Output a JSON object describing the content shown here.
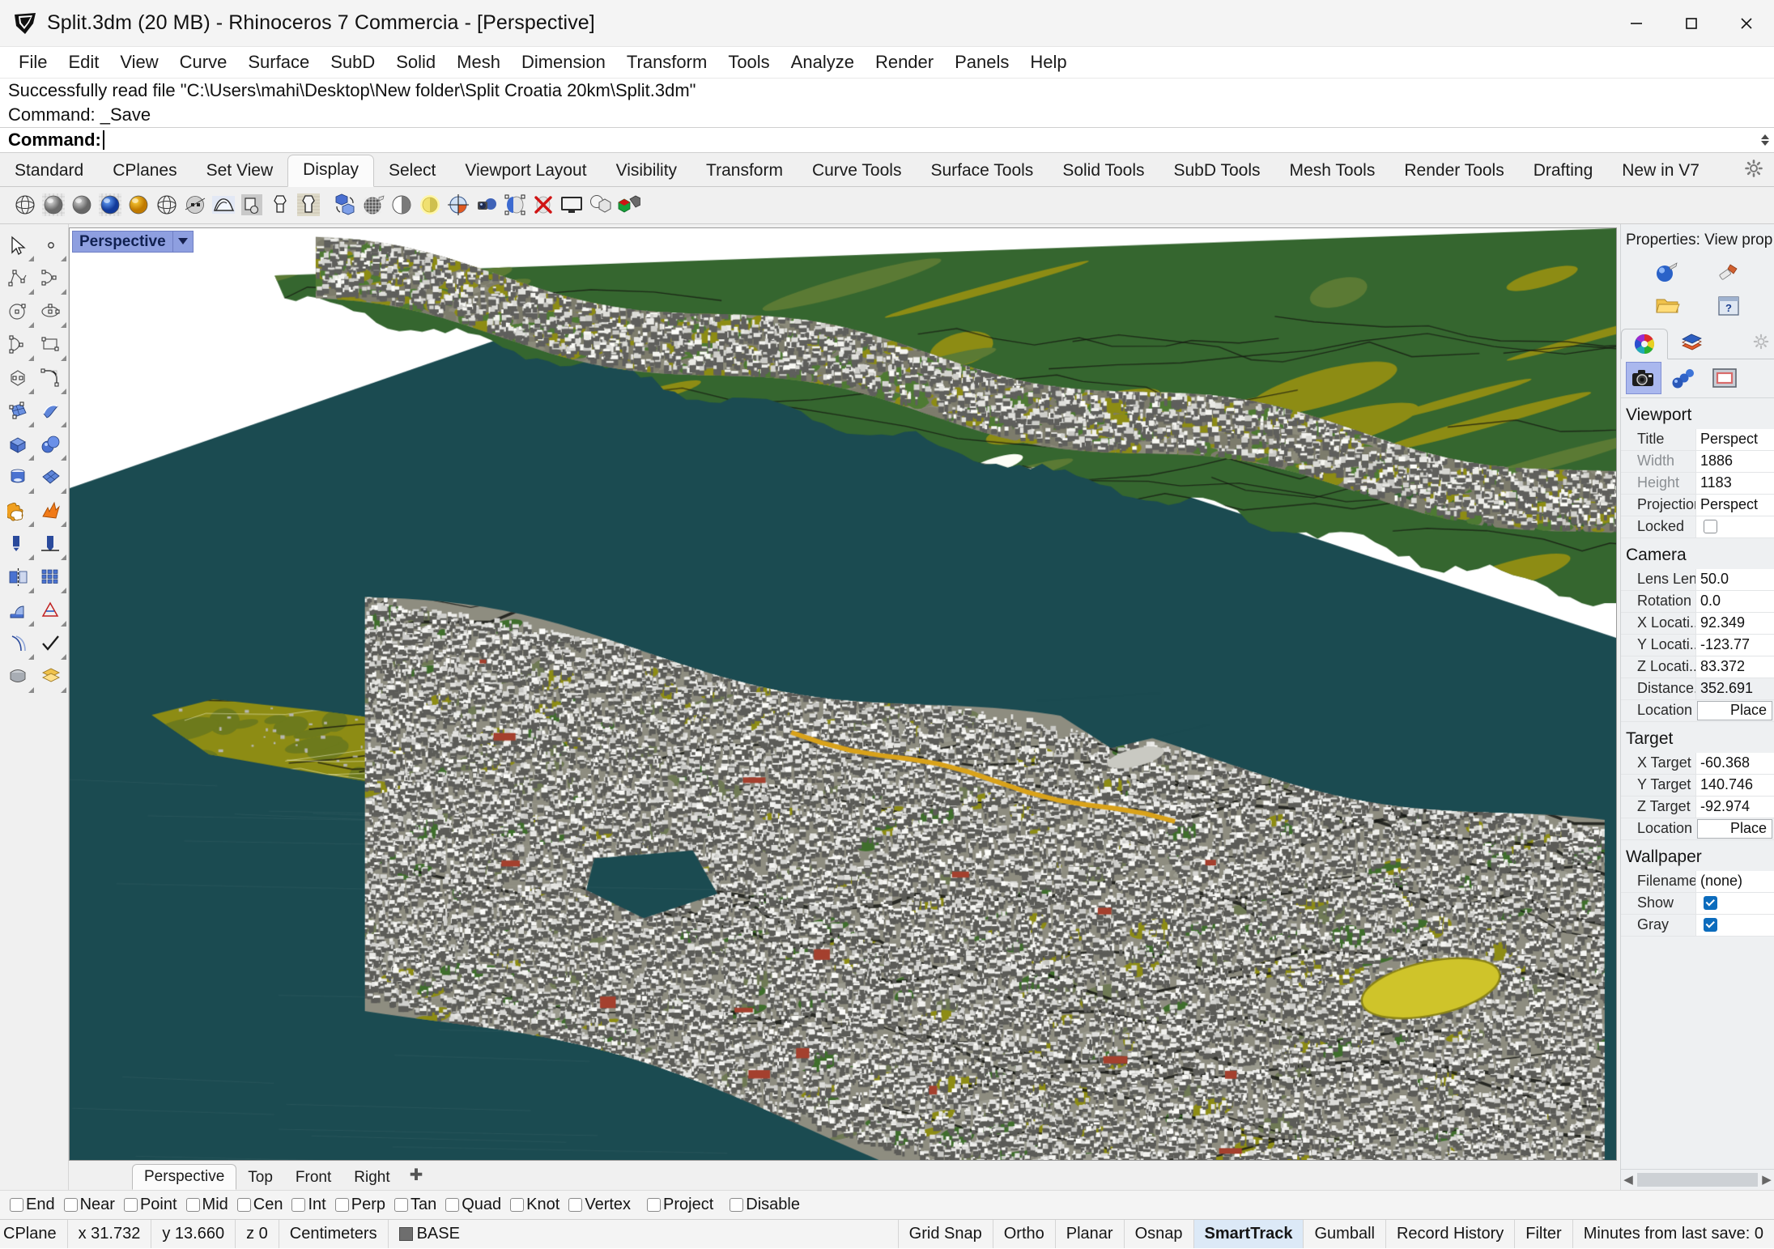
{
  "window": {
    "title": "Split.3dm (20 MB) - Rhinoceros 7 Commercia - [Perspective]",
    "icon": "rhinoceros-logo-icon",
    "minimize_label": "Minimize",
    "maximize_label": "Maximize",
    "close_label": "Close"
  },
  "menu": {
    "items": [
      "File",
      "Edit",
      "View",
      "Curve",
      "Surface",
      "SubD",
      "Solid",
      "Mesh",
      "Dimension",
      "Transform",
      "Tools",
      "Analyze",
      "Render",
      "Panels",
      "Help"
    ]
  },
  "command_area": {
    "history": [
      "Successfully read file \"C:\\Users\\mahi\\Desktop\\New folder\\Split Croatia 20km\\Split.3dm\"",
      "Command: _Save"
    ],
    "prompt_label": "Command:",
    "prompt_value": ""
  },
  "ribbon": {
    "tabs": [
      "Standard",
      "CPlanes",
      "Set View",
      "Display",
      "Select",
      "Viewport Layout",
      "Visibility",
      "Transform",
      "Curve Tools",
      "Surface Tools",
      "Solid Tools",
      "SubD Tools",
      "Mesh Tools",
      "Render Tools",
      "Drafting",
      "New in V7"
    ],
    "active_tab": "Display",
    "options_icon": "gear-icon",
    "toolbar_icons": [
      "wireframe-display-icon",
      "shaded-display-icon",
      "shaded-sphere-icon",
      "rendered-display-icon",
      "arctic-display-icon",
      "ghosted-display-icon",
      "xray-display-icon",
      "technical-display-icon",
      "pen-display-icon",
      "artistic-display-icon",
      "raytraced-display-icon",
      "separator",
      "toggle-display-mode-icon",
      "shade-selected-icon",
      "flat-shade-icon",
      "shade-highlight-icon",
      "render-preview-icon",
      "camera-icon",
      "clipping-plane-icon",
      "clipping-plane-off-icon",
      "fullscreen-icon",
      "shadows-icon",
      "render-colors-icon"
    ]
  },
  "left_toolbar": {
    "icons": [
      "select-arrow-icon",
      "point-icon",
      "polyline-icon",
      "curve-interpolate-icon",
      "circle-icon",
      "ellipse-icon",
      "arc-icon",
      "rectangle-icon",
      "polygon-icon",
      "fillet-curve-icon",
      "surface-from-curves-icon",
      "loft-surface-icon",
      "box-icon",
      "sphere-icon",
      "cylinder-icon",
      "surface-planar-icon",
      "boolean-union-icon",
      "explode-icon",
      "trim-icon",
      "split-icon",
      "mirror-icon",
      "array-icon",
      "fillet-edge-icon",
      "analyze-icon",
      "offset-icon",
      "check-icon",
      "paint-icon",
      "layer-icon"
    ]
  },
  "viewport": {
    "label": "Perspective",
    "dropdown_icon": "chevron-down-icon",
    "tabs": [
      "Perspective",
      "Top",
      "Front",
      "Right"
    ],
    "active_tab": "Perspective",
    "add_tab_icon": "plus-icon",
    "scene": {
      "description": "3D city model of Split, Croatia viewed in perspective",
      "sea_color": "#1b4b51",
      "background_color": "#ffffff",
      "forest_color": "#35662f",
      "olive_color": "#8d8c14",
      "urban_color": "#d2d2d0",
      "road_color": "#2a2a28"
    }
  },
  "properties_panel": {
    "title": "Properties: View prop...",
    "top_icons": [
      "material-sphere-icon",
      "paintbrush-icon",
      "open-folder-icon",
      "help-window-icon"
    ],
    "tab_icons": [
      "color-wheel-icon",
      "layers-icon"
    ],
    "active_tab": "color-wheel-icon",
    "gear_icon": "gear-icon",
    "sub_icons": [
      "camera-icon",
      "chain-links-icon",
      "wallpaper-frame-icon"
    ],
    "active_sub_icon": "camera-icon",
    "sections": [
      {
        "name": "Viewport",
        "rows": [
          {
            "label": "Title",
            "value": "Perspect",
            "type": "text",
            "dim": false
          },
          {
            "label": "Width",
            "value": "1886",
            "type": "text",
            "dim": true
          },
          {
            "label": "Height",
            "value": "1183",
            "type": "text",
            "dim": true
          },
          {
            "label": "Projection",
            "value": "Perspect",
            "type": "text",
            "dim": false
          },
          {
            "label": "Locked",
            "value": "",
            "type": "checkbox",
            "checked": false,
            "dim": false
          }
        ]
      },
      {
        "name": "Camera",
        "rows": [
          {
            "label": "Lens Len...",
            "value": "50.0",
            "type": "text",
            "dim": false
          },
          {
            "label": "Rotation",
            "value": "0.0",
            "type": "text",
            "dim": false
          },
          {
            "label": "X Locati...",
            "value": "92.349",
            "type": "text",
            "dim": false
          },
          {
            "label": "Y Locati...",
            "value": "-123.77",
            "type": "text",
            "dim": false
          },
          {
            "label": "Z Locati...",
            "value": "83.372",
            "type": "text",
            "dim": false
          },
          {
            "label": "Distance...",
            "value": "352.691",
            "type": "plain",
            "dim": false
          },
          {
            "label": "Location",
            "value": "Place",
            "type": "button",
            "dim": false
          }
        ]
      },
      {
        "name": "Target",
        "rows": [
          {
            "label": "X Target",
            "value": "-60.368",
            "type": "text",
            "dim": false
          },
          {
            "label": "Y Target",
            "value": "140.746",
            "type": "text",
            "dim": false
          },
          {
            "label": "Z Target",
            "value": "-92.974",
            "type": "text",
            "dim": false
          },
          {
            "label": "Location",
            "value": "Place",
            "type": "button",
            "dim": false
          }
        ]
      },
      {
        "name": "Wallpaper",
        "rows": [
          {
            "label": "Filename",
            "value": "(none)",
            "type": "text",
            "dim": false
          },
          {
            "label": "Show",
            "value": "",
            "type": "checkbox",
            "checked": true,
            "dim": false
          },
          {
            "label": "Gray",
            "value": "",
            "type": "checkbox",
            "checked": true,
            "dim": false
          }
        ]
      }
    ],
    "scroll_left_icon": "chevron-left-icon",
    "scroll_right_icon": "chevron-right-icon"
  },
  "osnap_bar": {
    "items": [
      {
        "label": "End",
        "checked": false
      },
      {
        "label": "Near",
        "checked": false
      },
      {
        "label": "Point",
        "checked": false
      },
      {
        "label": "Mid",
        "checked": false
      },
      {
        "label": "Cen",
        "checked": false
      },
      {
        "label": "Int",
        "checked": false
      },
      {
        "label": "Perp",
        "checked": false
      },
      {
        "label": "Tan",
        "checked": false
      },
      {
        "label": "Quad",
        "checked": false
      },
      {
        "label": "Knot",
        "checked": false
      },
      {
        "label": "Vertex",
        "checked": false
      },
      {
        "label": "Project",
        "checked": false
      },
      {
        "label": "Disable",
        "checked": false
      }
    ]
  },
  "status_bar": {
    "cplane": "CPlane",
    "x": "x 31.732",
    "y": "y 13.660",
    "z": "z 0",
    "units": "Centimeters",
    "layer": "BASE",
    "layer_color": "#6e6e6e",
    "toggles": [
      {
        "label": "Grid Snap",
        "active": false
      },
      {
        "label": "Ortho",
        "active": false
      },
      {
        "label": "Planar",
        "active": false
      },
      {
        "label": "Osnap",
        "active": false
      },
      {
        "label": "SmartTrack",
        "active": true
      },
      {
        "label": "Gumball",
        "active": false
      },
      {
        "label": "Record History",
        "active": false
      },
      {
        "label": "Filter",
        "active": false
      }
    ],
    "save_info": "Minutes from last save: 0"
  }
}
